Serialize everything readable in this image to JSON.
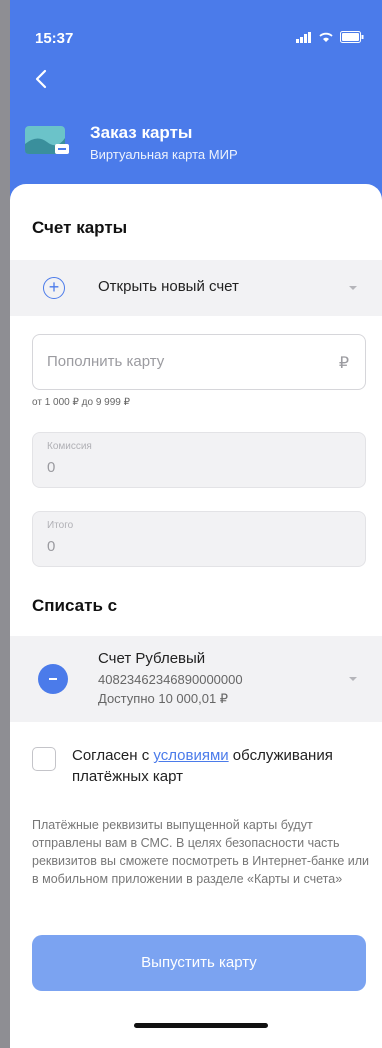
{
  "status_bar": {
    "time": "15:37"
  },
  "header": {
    "title": "Заказ карты",
    "subtitle": "Виртуальная карта МИР"
  },
  "account_section": {
    "title": "Счет карты",
    "selected_option": "Открыть новый счет"
  },
  "topup": {
    "placeholder": "Пополнить карту",
    "currency_symbol": "₽",
    "range_hint": "от 1 000 ₽ до 9 999 ₽"
  },
  "commission": {
    "label": "Комиссия",
    "value": "0"
  },
  "total": {
    "label": "Итого",
    "value": "0"
  },
  "debit_section": {
    "title": "Списать с",
    "account_name": "Счет Рублевый",
    "account_number": "40823462346890000000",
    "available": "Доступно 10 000,01 ₽"
  },
  "agreement": {
    "prefix": "Согласен с ",
    "link": "условиями",
    "suffix": " обслуживания платёжных карт",
    "checked": false
  },
  "info_text": "Платёжные реквизиты выпущенной карты будут отправлены вам в СМС. В целях безопасности часть реквизитов вы сможете посмотреть в Интернет-банке или в мобильном приложении в разделе «Карты и счета»",
  "submit": {
    "label": "Выпустить карту"
  },
  "colors": {
    "brand": "#4b7bea",
    "button_disabled": "#7ba3f1"
  },
  "icons": [
    "back-arrow-icon",
    "card-icon",
    "plus-icon",
    "chevron-down-icon",
    "ruble-icon",
    "account-icon",
    "signal-icon",
    "wifi-icon",
    "battery-icon"
  ]
}
